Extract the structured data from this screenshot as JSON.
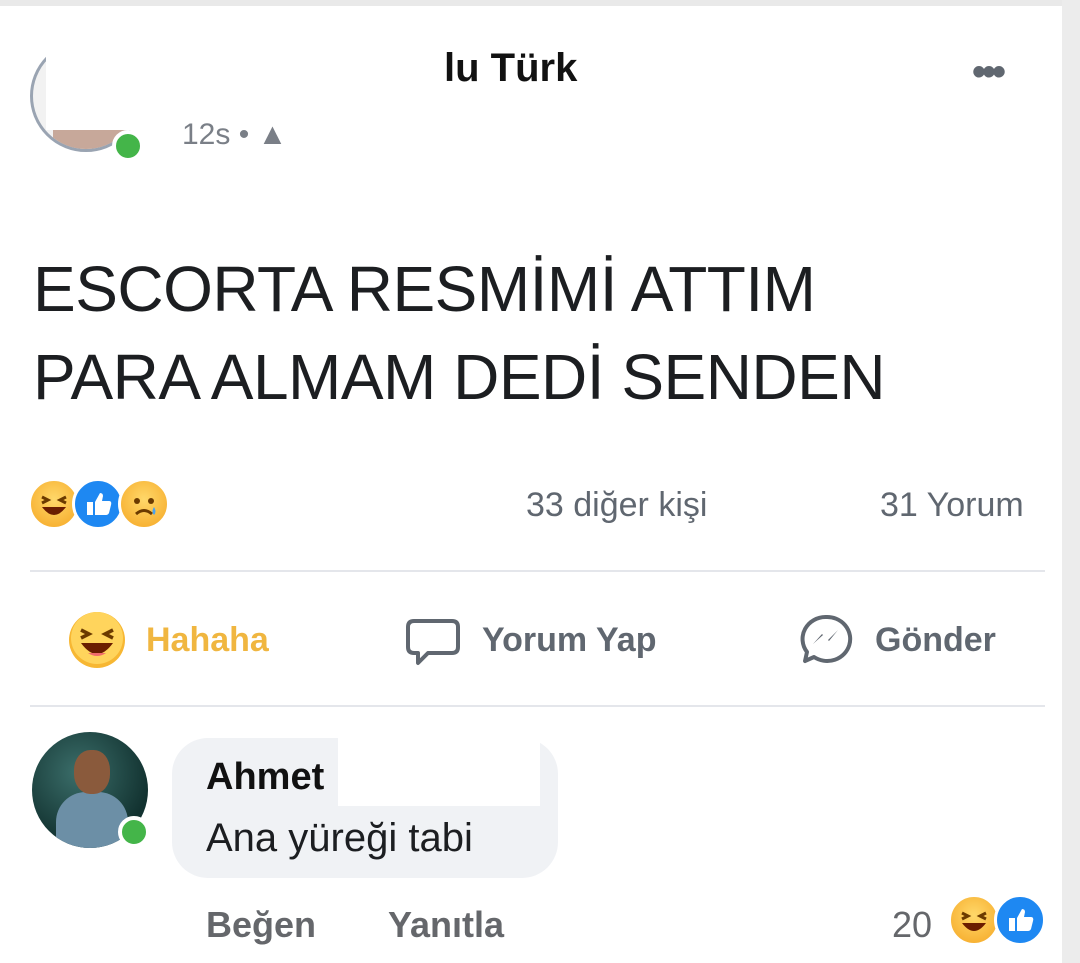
{
  "post": {
    "author": "lu Türk",
    "timestamp": "12s •",
    "more_label": "•••",
    "text_line1": "ESCORTA RESMİMİ ATTIM",
    "text_line2": "PARA ALMAM DEDİ SENDEN"
  },
  "summary": {
    "reaction_icons": [
      "haha-icon",
      "like-icon",
      "sad-icon"
    ],
    "others": "33 diğer kişi",
    "comments": "31 Yorum"
  },
  "actions": {
    "react_label": "Hahaha",
    "comment_label": "Yorum Yap",
    "send_label": "Gönder"
  },
  "comment": {
    "author": "Ahmet",
    "text": "Ana yüreği tabi",
    "like_label": "Beğen",
    "reply_label": "Yanıtla",
    "reaction_count": "20",
    "reaction_icons": [
      "haha-icon",
      "like-icon"
    ]
  },
  "colors": {
    "haha_active": "#f0b640",
    "like_blue": "#1e88f2",
    "online_green": "#44b549",
    "muted_text": "#606770",
    "bubble_bg": "#f0f2f5"
  }
}
